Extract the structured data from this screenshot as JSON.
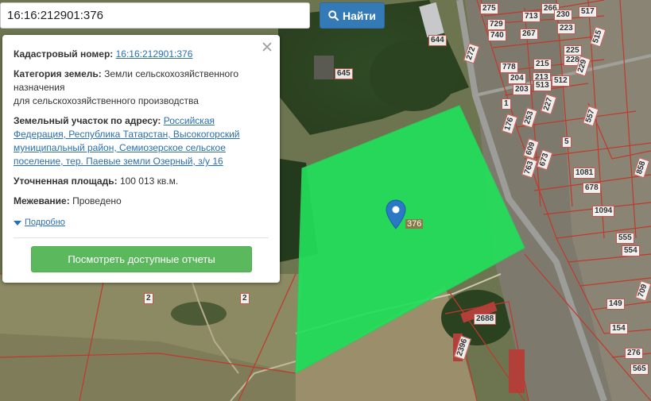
{
  "search": {
    "value": "16:16:212901:376",
    "button_label": "Найти"
  },
  "popup": {
    "cadastral_label": "Кадастровый номер:",
    "cadastral_value": "16:16:212901:376",
    "category_label": "Категория земель:",
    "category_value_1": "Земли сельскохозяйственного назначения",
    "category_value_2": "для сельскохозяйственного производства",
    "address_label": "Земельный участок по адресу:",
    "address_value": "Российская Федерация, Республика Татарстан, Высокогорский муниципальный район, Семиозерское сельское поселение, тер. Паевые земли Озерный, з/у 16",
    "area_label": "Уточненная площадь:",
    "area_value": "100 013 кв.м.",
    "survey_label": "Межевание:",
    "survey_value": "Проведено",
    "more_link": "Подробно",
    "reports_button": "Посмотреть доступные отчеты"
  },
  "map": {
    "selected_parcel_label": "376",
    "parcel_color": "#22e05a",
    "boundary_color": "#c0392b",
    "labels": [
      "644",
      "645",
      "272",
      "275",
      "713",
      "266",
      "230",
      "517",
      "729",
      "740",
      "267",
      "223",
      "515",
      "225",
      "778",
      "215",
      "228",
      "204",
      "213",
      "513",
      "512",
      "229",
      "203",
      "1",
      "227",
      "557",
      "176",
      "253",
      "5",
      "609",
      "673",
      "763",
      "1081",
      "678",
      "1094",
      "555",
      "554",
      "149",
      "154",
      "276",
      "565",
      "709",
      "2688",
      "2396",
      "2",
      "2",
      "858"
    ]
  }
}
